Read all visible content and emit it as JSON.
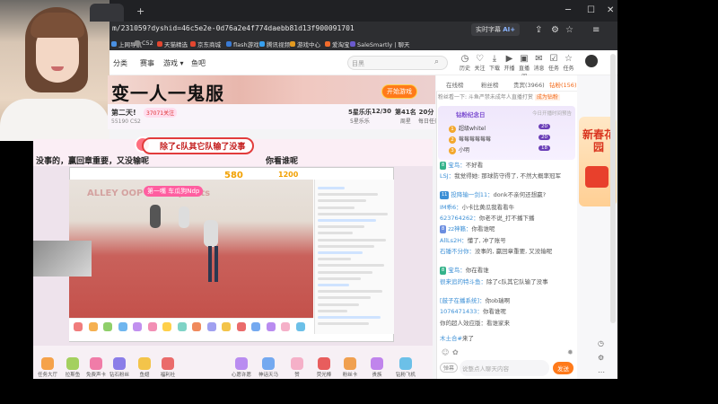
{
  "browser": {
    "url": "m/231059?dyshid=46c5e2e-0d76a2e4f774daebb81d13f900091701",
    "buttons": {
      "realtime": "实时字幕",
      "ai": "AI+"
    },
    "bookmarks": [
      "上网导航",
      "C52",
      "天猫精选",
      "京东商城",
      "flash游戏",
      "腾讯视频",
      "游戏中心",
      "爱淘宝",
      "SaleSmartly | 聊天"
    ]
  },
  "nav": {
    "items": [
      "分类",
      "赛事",
      "游戏 ▾",
      "鱼吧"
    ],
    "search_placeholder": "目黑",
    "icons": [
      {
        "label": "历史",
        "glyph": "◷"
      },
      {
        "label": "关注",
        "glyph": "♡"
      },
      {
        "label": "下载",
        "glyph": "⤓"
      },
      {
        "label": "开播",
        "glyph": "▶"
      },
      {
        "label": "直播间",
        "glyph": "▣"
      },
      {
        "label": "消息",
        "glyph": "✉"
      },
      {
        "label": "任务",
        "glyph": "☑"
      },
      {
        "label": "任务",
        "glyph": "☆"
      }
    ]
  },
  "banner": {
    "text": "变一人一鬼服",
    "button": "开始游戏"
  },
  "room": {
    "title": "第二天!",
    "id": "55190",
    "tag": "CS2",
    "follow": "37071关注",
    "stats": [
      {
        "value": "5星乐乐",
        "label": "5星乐乐"
      },
      {
        "value": "12/30",
        "label": ""
      },
      {
        "value": "第41名",
        "label": "周星"
      },
      {
        "value": "20分 ▾",
        "label": "每日任务"
      }
    ]
  },
  "stream": {
    "danmu": "除了c队其它队输了没事",
    "caption_left": "没事的，赢回章重要，又没输呢",
    "caption_right": "你看谁呢",
    "court_sign": "ALLEY OOP  Three points",
    "inner_banner": "第一嘴 车瓜狗Ndp",
    "score_a": "580",
    "score_b": "1200"
  },
  "gifts": [
    {
      "label": "任务大厅",
      "color": "#f5a24a"
    },
    {
      "label": "拉斯鱼",
      "color": "#a4d05f"
    },
    {
      "label": "免费声卡",
      "color": "#f07ca8"
    },
    {
      "label": "钻石粉丝",
      "color": "#8b7de8"
    },
    {
      "label": "鱼翅",
      "color": "#f3c44a"
    },
    {
      "label": "福利社",
      "color": "#ea6b6b"
    },
    {
      "label": "心愿许愿",
      "color": "#b98cf0"
    },
    {
      "label": "神话天马",
      "color": "#74a9f0"
    },
    {
      "label": "赞",
      "color": "#f5b0c8"
    },
    {
      "label": "荧光棒",
      "color": "#e85d5d"
    },
    {
      "label": "粉丝卡",
      "color": "#f0a050"
    },
    {
      "label": "贵族",
      "color": "#c084ec"
    },
    {
      "label": "钻粉飞机",
      "color": "#6cc0e8"
    }
  ],
  "chat": {
    "tabs": [
      "在线榜",
      "粉丝榜",
      "贵宾(3966)",
      "钻粉(156)"
    ],
    "notice": "粉丝看一下: 斗鱼严禁未成年人直播打赏",
    "notice_link": "成为钻粉",
    "rank_title": "钻粉纪念日",
    "rank_preview": "今日开播时间预告",
    "rank": [
      {
        "n": "1",
        "name": "超级whitel",
        "val": "20"
      },
      {
        "n": "2",
        "name": "莓莓莓莓莓莓",
        "val": "20"
      },
      {
        "n": "3",
        "name": "小明",
        "val": "18"
      }
    ],
    "messages": [
      {
        "lv": "8",
        "lvc": "#34b38a",
        "user": "宝鸟：",
        "text": "不好看"
      },
      {
        "lv": "",
        "lvc": "",
        "user": "LSJ：",
        "text": "我觉得她: 那球防守得了, 不然大概率冠军"
      },
      {
        "lv": "11",
        "lvc": "#3b8fd6",
        "user": "投降输一剑11：",
        "text": "donk不亲何还想赢?"
      },
      {
        "lv": "",
        "lvc": "",
        "user": "IM乖6：",
        "text": "小卡比黄瓜我看看牛"
      },
      {
        "lv": "",
        "lvc": "",
        "user": "623764262：",
        "text": "你老不说_打不播下播"
      },
      {
        "lv": "8",
        "lvc": "#6b8de0",
        "user": "zz神籁：",
        "text": "你看谁呢"
      },
      {
        "lv": "",
        "lvc": "",
        "user": "AllLs2H：",
        "text": "懂了, 冲了账号"
      },
      {
        "lv": "",
        "lvc": "",
        "user": "石锤不分你：",
        "text": "没事的, 赢回章重要, 又没输呢"
      },
      {
        "lv": "8",
        "lvc": "#34b38a",
        "user": "宝鸟：",
        "text": "你在看谁"
      },
      {
        "lv": "",
        "lvc": "",
        "user": "很来追的特斗鱼：",
        "text": "除了c队其它队输了没事"
      },
      {
        "lv": "",
        "lvc": "",
        "user": "[鼓子在播系统]：",
        "text": "你ob瑞啊"
      },
      {
        "lv": "",
        "lvc": "",
        "user": "1076471433：",
        "text": "你看谁呢"
      },
      {
        "lv": "",
        "lvc": "",
        "user": "",
        "text": "你的超人效应版：看谁家来"
      },
      {
        "lv": "",
        "lvc": "",
        "user": "木土合#",
        "text": "来了"
      }
    ],
    "input_placeholder": "说整点人聊天内容",
    "send": "发送",
    "barrage": "弹幕"
  },
  "sidebar": {
    "festival": "新春花园"
  }
}
